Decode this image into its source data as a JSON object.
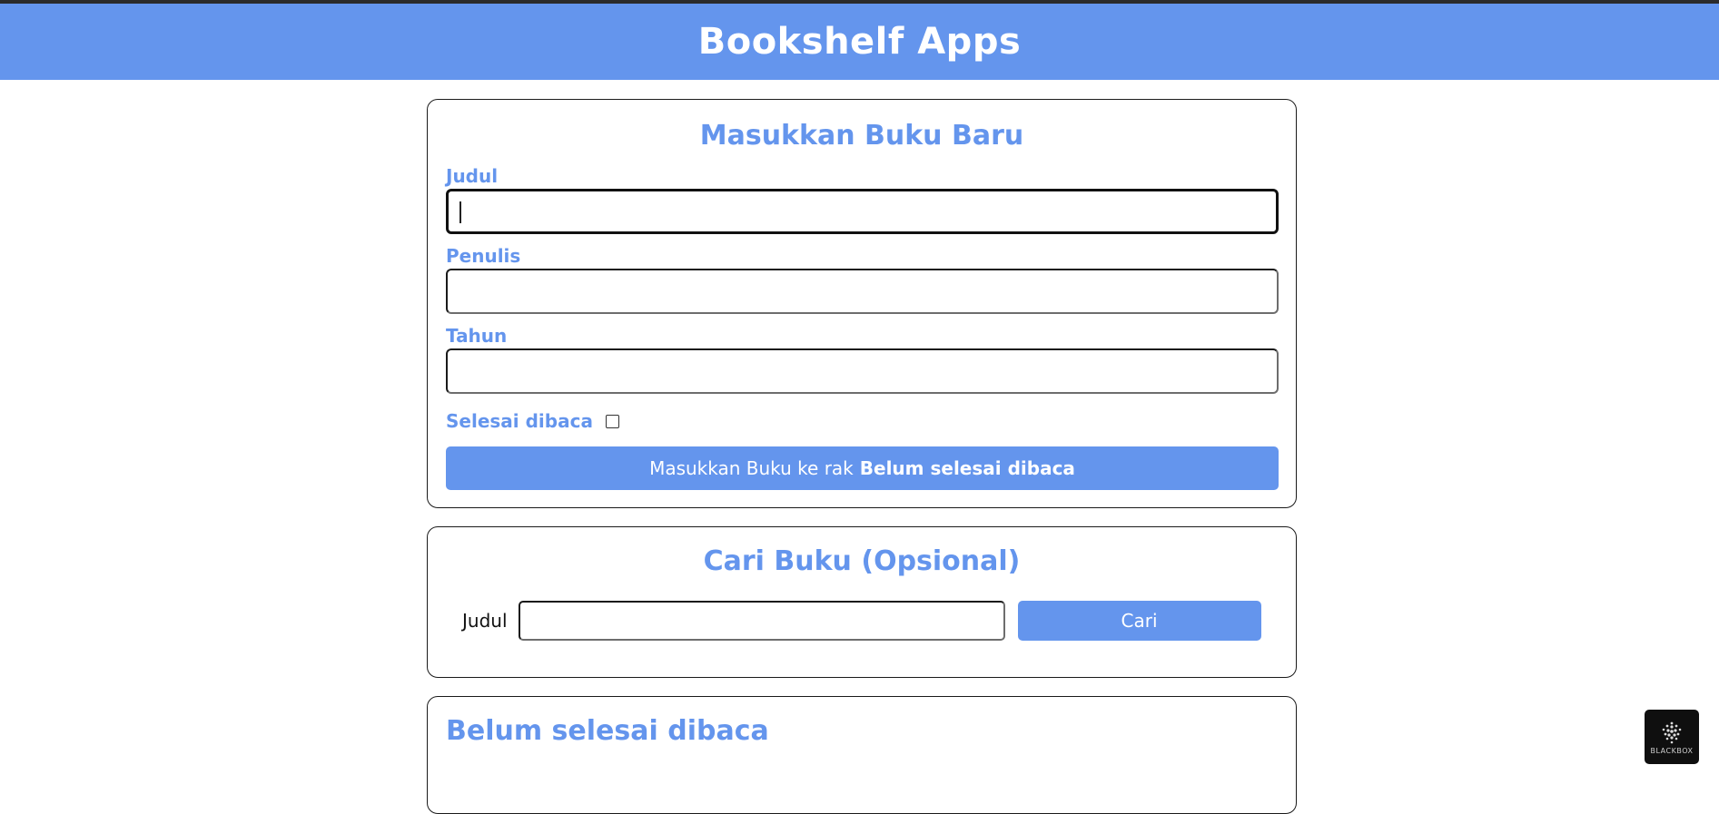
{
  "header": {
    "title": "Bookshelf Apps"
  },
  "input_section": {
    "title": "Masukkan Buku Baru",
    "fields": {
      "title_label": "Judul",
      "author_label": "Penulis",
      "year_label": "Tahun",
      "complete_label": "Selesai dibaca",
      "title_value": "",
      "author_value": "",
      "year_value": ""
    },
    "complete_checked": false,
    "submit_prefix": "Masukkan Buku ke rak",
    "submit_shelf": "Belum selesai dibaca"
  },
  "search_section": {
    "title": "Cari Buku (Opsional)",
    "label": "Judul",
    "value": "",
    "button": "Cari"
  },
  "incomplete_shelf": {
    "title": "Belum selesai dibaca"
  },
  "badge": {
    "text": "BLACKBOX",
    "icon": "dots-logo-icon"
  },
  "colors": {
    "accent": "#6495ed",
    "text": "#111111"
  }
}
